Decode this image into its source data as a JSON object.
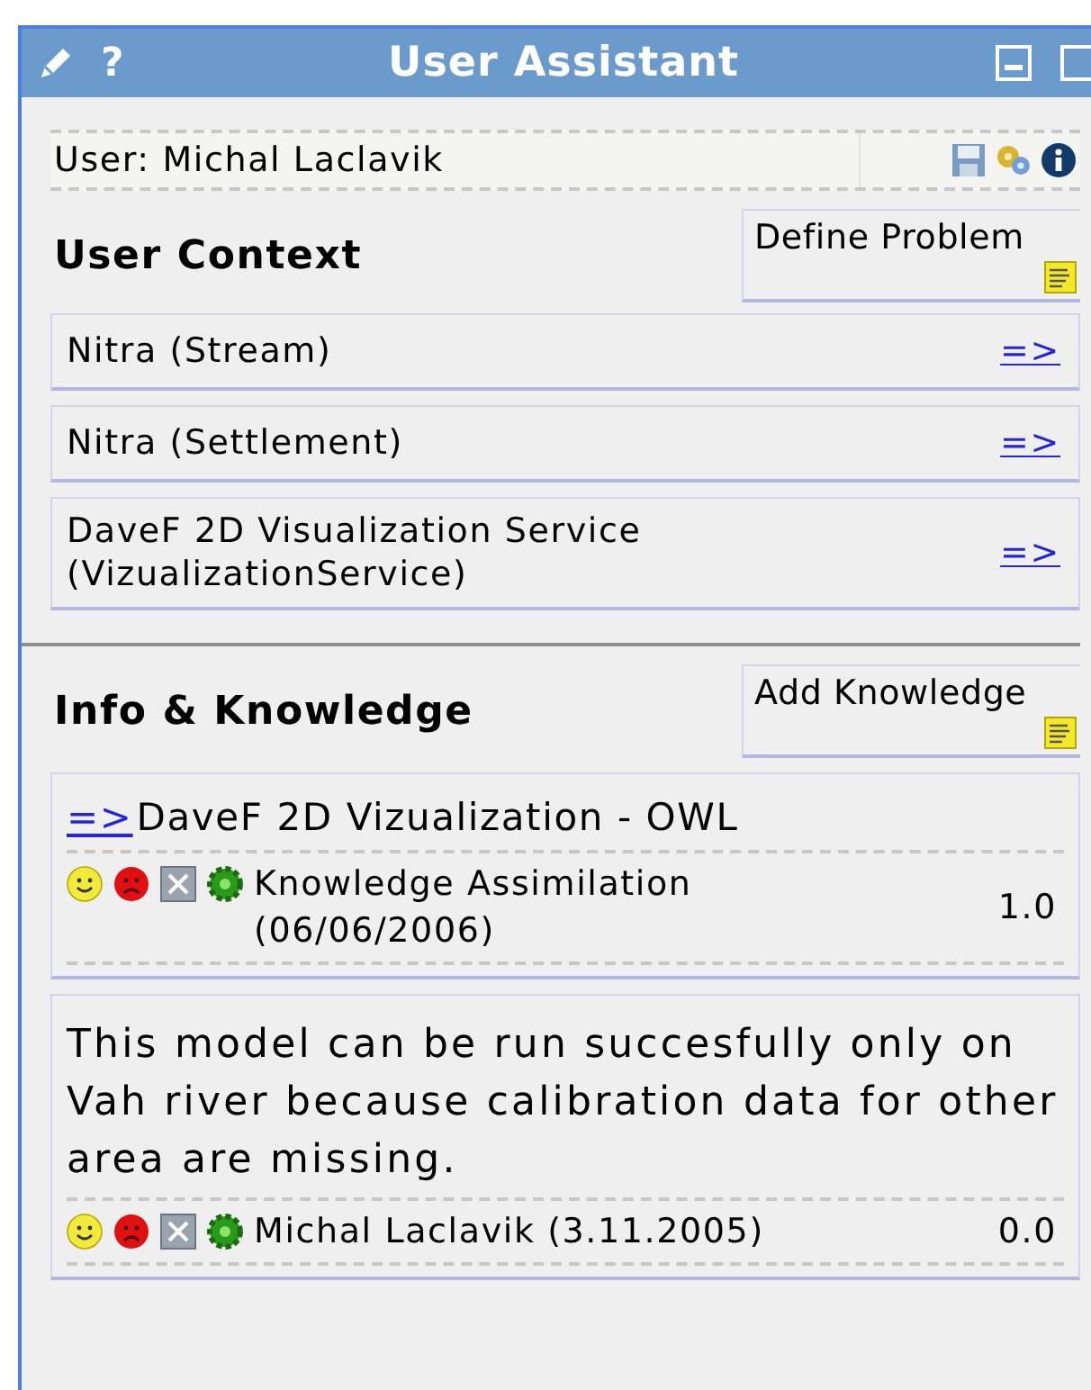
{
  "window": {
    "title": "User Assistant",
    "help": "?"
  },
  "user_bar": {
    "label": "User: Michal Laclavik"
  },
  "context": {
    "title": "User Context",
    "button": "Define Problem",
    "items": [
      {
        "label": "Nitra (Stream)",
        "link": "=>"
      },
      {
        "label": "Nitra (Settlement)",
        "link": "=>"
      },
      {
        "label": "DaveF 2D Visualization Service (VizualizationService)",
        "link": "=>"
      }
    ]
  },
  "knowledge": {
    "title": "Info & Knowledge",
    "button": "Add Knowledge",
    "entries": [
      {
        "kind": "linked",
        "link": "=>",
        "title": "DaveF 2D Vizualization - OWL",
        "author": "Knowledge Assimilation (06/06/2006)",
        "score": "1.0"
      },
      {
        "kind": "note",
        "text": "This model can be run succesfully only on Vah river because calibration data for other area are missing.",
        "author": "Michal Laclavik (3.11.2005)",
        "score": "0.0"
      }
    ]
  }
}
